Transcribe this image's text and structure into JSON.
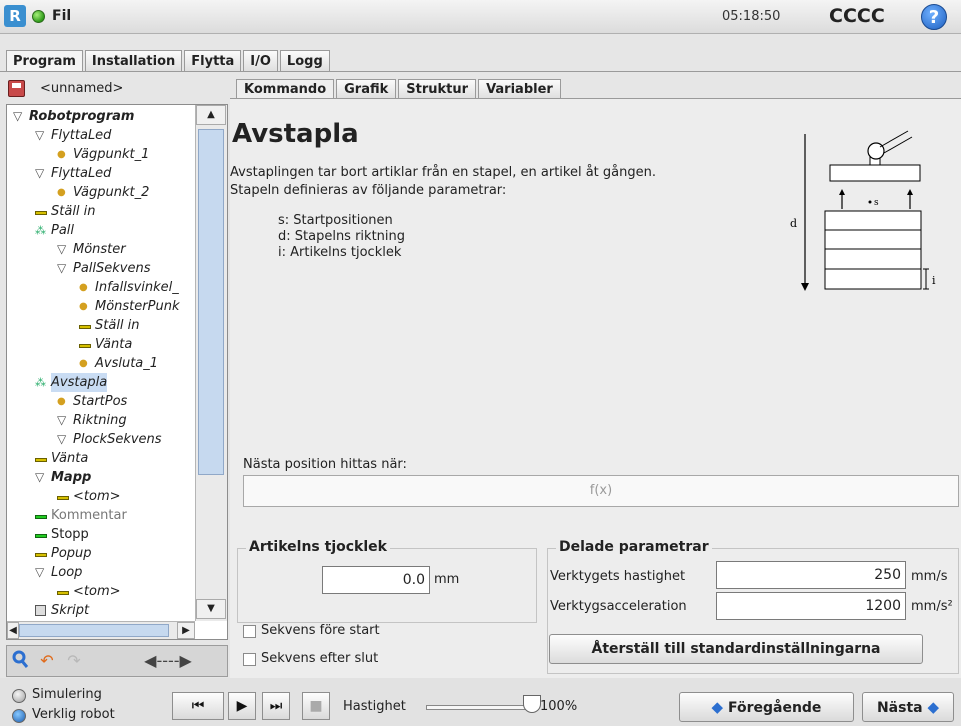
{
  "header": {
    "file_label": "Fil",
    "time": "05:18:50",
    "robot_name": "CCCC",
    "help_glyph": "?"
  },
  "main_tabs": [
    {
      "label": "Program",
      "active": true
    },
    {
      "label": "Installation",
      "active": false
    },
    {
      "label": "Flytta",
      "active": false
    },
    {
      "label": "I/O",
      "active": false
    },
    {
      "label": "Logg",
      "active": false
    }
  ],
  "left": {
    "filename": "<unnamed>",
    "tree": [
      {
        "label": "Robotprogram",
        "icon": "triangle-down",
        "level": 0
      },
      {
        "label": "FlyttaLed",
        "icon": "triangle-down",
        "level": 1
      },
      {
        "label": "Vägpunkt_1",
        "icon": "waypoint",
        "level": 2
      },
      {
        "label": "FlyttaLed",
        "icon": "triangle-down",
        "level": 1
      },
      {
        "label": "Vägpunkt_2",
        "icon": "waypoint",
        "level": 2
      },
      {
        "label": "Ställ in",
        "icon": "bar",
        "level": 1
      },
      {
        "label": "Pall",
        "icon": "dots",
        "level": 1
      },
      {
        "label": "Mönster",
        "icon": "triangle-down",
        "level": 2
      },
      {
        "label": "PallSekvens",
        "icon": "triangle-down",
        "level": 2
      },
      {
        "label": "Infallsvinkel_",
        "icon": "waypoint",
        "level": 3
      },
      {
        "label": "MönsterPunk",
        "icon": "waypoint",
        "level": 3
      },
      {
        "label": "Ställ in",
        "icon": "bar",
        "level": 3
      },
      {
        "label": "Vänta",
        "icon": "bar",
        "level": 3
      },
      {
        "label": "Avsluta_1",
        "icon": "waypoint",
        "level": 3
      },
      {
        "label": "Avstapla",
        "icon": "dots",
        "level": 1
      },
      {
        "label": "StartPos",
        "icon": "waypoint",
        "level": 2
      },
      {
        "label": "Riktning",
        "icon": "triangle-down",
        "level": 2
      },
      {
        "label": "PlockSekvens",
        "icon": "triangle-down",
        "level": 2
      },
      {
        "label": "Vänta",
        "icon": "bar",
        "level": 1
      },
      {
        "label": "Mapp",
        "icon": "triangle-down",
        "level": 1
      },
      {
        "label": "<tom>",
        "icon": "bar",
        "level": 2
      },
      {
        "label": "Kommentar",
        "icon": "bar-green",
        "level": 1
      },
      {
        "label": "Stopp",
        "icon": "bar-green",
        "level": 1
      },
      {
        "label": "Popup",
        "icon": "bar",
        "level": 1
      },
      {
        "label": "Loop",
        "icon": "triangle-down",
        "level": 1
      },
      {
        "label": "<tom>",
        "icon": "bar",
        "level": 2
      },
      {
        "label": "Skript",
        "icon": "script",
        "level": 1
      }
    ]
  },
  "sub_tabs": [
    {
      "label": "Kommando",
      "active": true
    },
    {
      "label": "Grafik",
      "active": false
    },
    {
      "label": "Struktur",
      "active": false
    },
    {
      "label": "Variabler",
      "active": false
    }
  ],
  "command": {
    "title": "Avstapla",
    "description_line1": "Avstaplingen tar bort artiklar från en stapel, en artikel åt gången.",
    "description_line2": "Stapeln definieras av följande parametrar:",
    "param_s": "s: Startpositionen",
    "param_d": "d: Stapelns riktning",
    "param_i": "i: Artikelns tjocklek",
    "diagram_labels": {
      "d": "d",
      "s": "s",
      "i": "i"
    },
    "next_position_label": "Nästa position hittas när:",
    "expression_placeholder": "f(x)",
    "thickness_group_title": "Artikelns tjocklek",
    "thickness_value": "0.0",
    "thickness_unit": "mm",
    "shared_group_title": "Delade parametrar",
    "tool_speed_label": "Verktygets hastighet",
    "tool_speed_value": "250",
    "tool_speed_unit": "mm/s",
    "tool_accel_label": "Verktygsacceleration",
    "tool_accel_value": "1200",
    "tool_accel_unit": "mm/s²",
    "checkbox_before": "Sekvens före start",
    "checkbox_after": "Sekvens efter slut",
    "reset_button": "Återställ till standardinställningarna"
  },
  "footer": {
    "sim_label": "Simulering",
    "real_label": "Verklig robot",
    "speed_label": "Hastighet",
    "speed_value": "100%",
    "speed_fraction": 1.0,
    "prev_button": "Föregående",
    "next_button": "Nästa"
  },
  "colors": {
    "accent_blue": "#2c6fd0",
    "status_green": "#2f9b1a",
    "selection": "#c9dcf3"
  }
}
